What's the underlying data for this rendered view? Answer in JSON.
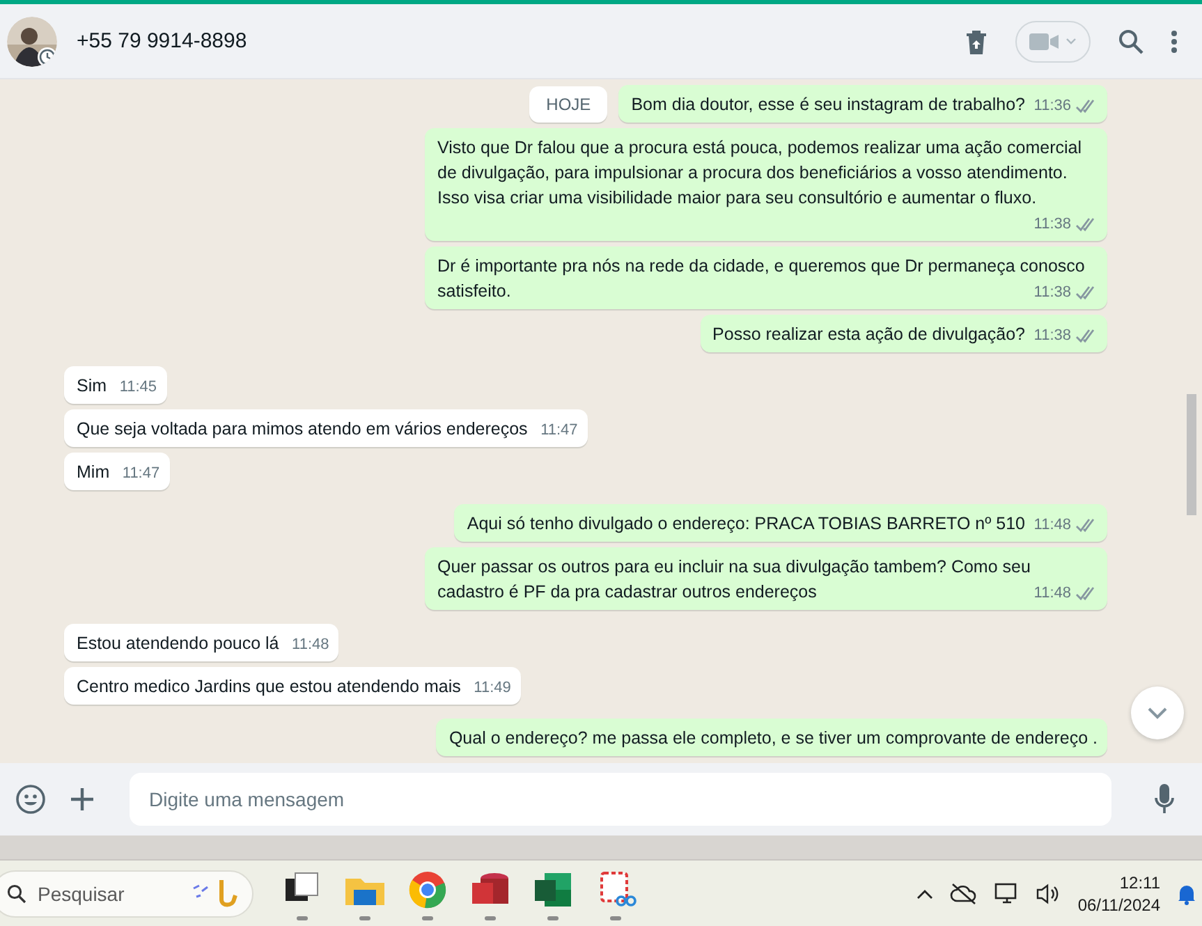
{
  "header": {
    "contact": "+55 79 9914-8898"
  },
  "date_chip": "HOJE",
  "messages": [
    {
      "outgoing": true,
      "text": "Bom dia doutor, esse é seu instagram de trabalho?",
      "time": "11:36",
      "read": false
    },
    {
      "outgoing": true,
      "text": "Visto que Dr falou que a procura está pouca, podemos realizar uma ação comercial de divulgação, para impulsionar a procura dos beneficiários a vosso atendimento. Isso visa criar uma visibilidade maior para seu consultório e aumentar o fluxo.",
      "time": "11:38",
      "read": false
    },
    {
      "outgoing": true,
      "text": "Dr é importante pra nós na rede da cidade, e queremos que Dr permaneça conosco satisfeito.",
      "time": "11:38",
      "read": false
    },
    {
      "outgoing": true,
      "text": "Posso realizar esta ação de divulgação?",
      "time": "11:38",
      "read": false
    },
    {
      "outgoing": false,
      "text": "Sim",
      "time": "11:45"
    },
    {
      "outgoing": false,
      "text": "Que seja voltada para mimos atendo em vários endereços",
      "time": "11:47"
    },
    {
      "outgoing": false,
      "text": "Mim",
      "time": "11:47"
    },
    {
      "outgoing": true,
      "text": "Aqui só tenho divulgado o endereço: PRACA TOBIAS BARRETO nº 510",
      "time": "11:48",
      "read": false
    },
    {
      "outgoing": true,
      "text": "Quer passar os outros para eu incluir na sua divulgação tambem? Como seu cadastro é PF da pra cadastrar outros endereços",
      "time": "11:48",
      "read": false
    },
    {
      "outgoing": false,
      "text": "Estou atendendo pouco lá",
      "time": "11:48"
    },
    {
      "outgoing": false,
      "text": "Centro medico Jardins que estou atendendo mais",
      "time": "11:49"
    },
    {
      "outgoing": true,
      "text": "Qual o endereço? me passa ele completo, e se tiver um comprovante de endereço ."
    }
  ],
  "composer": {
    "placeholder": "Digite uma mensagem"
  },
  "taskbar": {
    "search_placeholder": "Pesquisar",
    "time": "12:11",
    "date": "06/11/2024"
  }
}
